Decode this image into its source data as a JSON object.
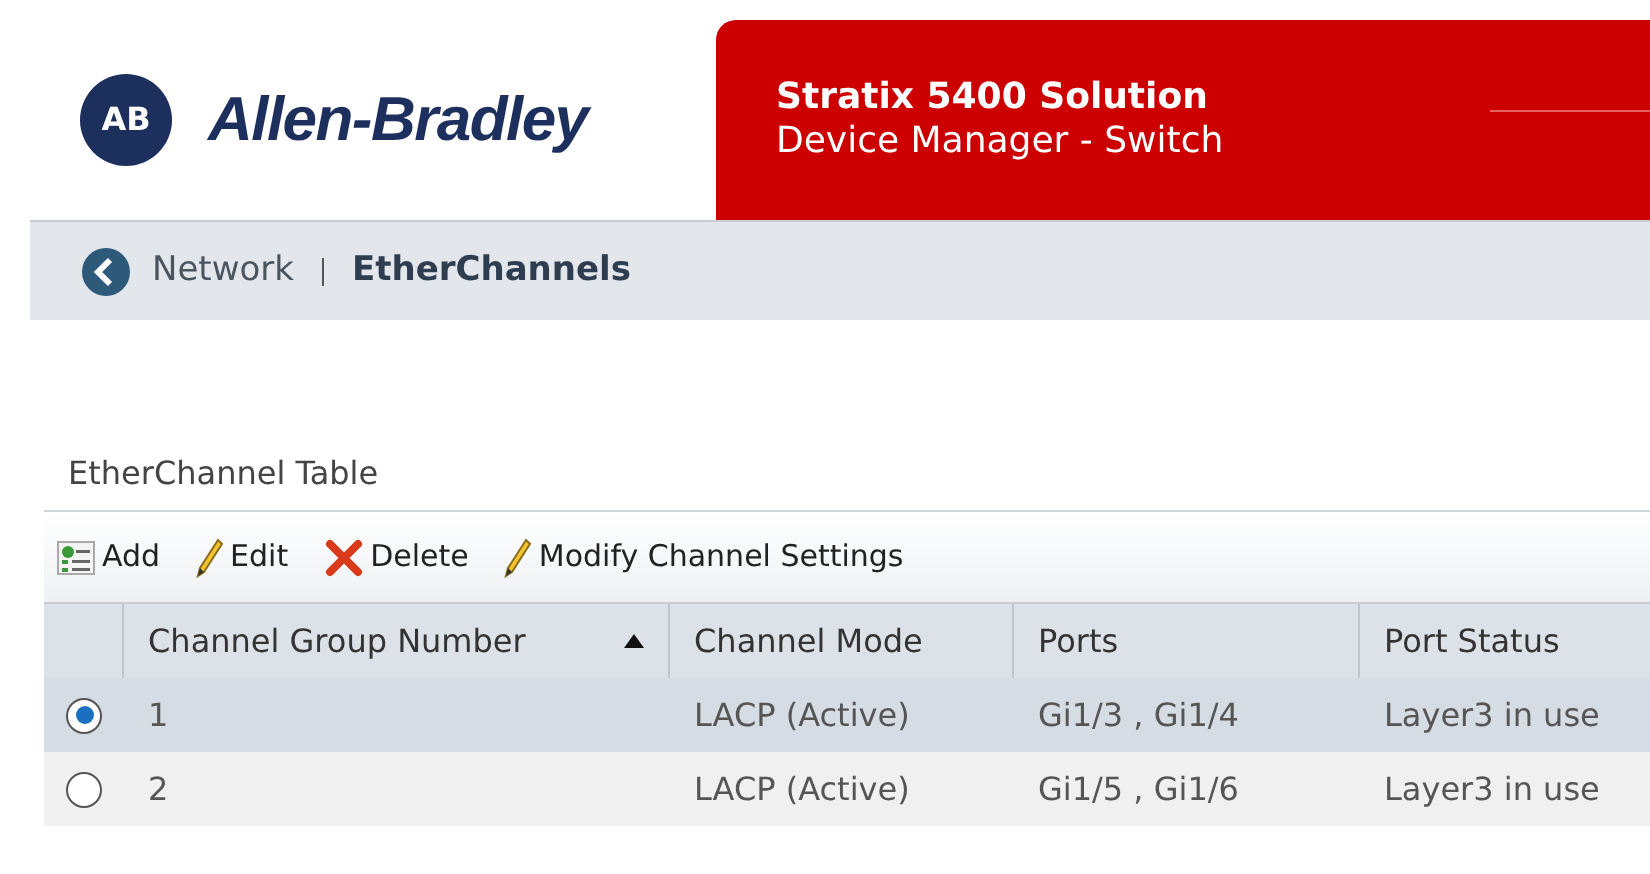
{
  "header": {
    "logo_mark": "AB",
    "brand": "Allen-Bradley",
    "product": "Stratix 5400 Solution",
    "subtitle": "Device Manager - Switch"
  },
  "breadcrumb": {
    "parent": "Network",
    "current": "EtherChannels"
  },
  "table": {
    "title": "EtherChannel Table",
    "toolbar": [
      {
        "kind": "add",
        "label": "Add"
      },
      {
        "kind": "edit",
        "label": "Edit"
      },
      {
        "kind": "delete",
        "label": "Delete"
      },
      {
        "kind": "edit",
        "label": "Modify Channel Settings"
      }
    ],
    "columns": [
      {
        "label": "Channel Group Number",
        "sorted": true
      },
      {
        "label": "Channel Mode",
        "sorted": false
      },
      {
        "label": "Ports",
        "sorted": false
      },
      {
        "label": "Port Status",
        "sorted": false
      }
    ],
    "rows": [
      {
        "selected": true,
        "cells": [
          "1",
          "LACP (Active)",
          "Gi1/3 , Gi1/4",
          "Layer3 in use"
        ]
      },
      {
        "selected": false,
        "cells": [
          "2",
          "LACP (Active)",
          "Gi1/5 , Gi1/6",
          "Layer3 in use"
        ]
      }
    ]
  }
}
